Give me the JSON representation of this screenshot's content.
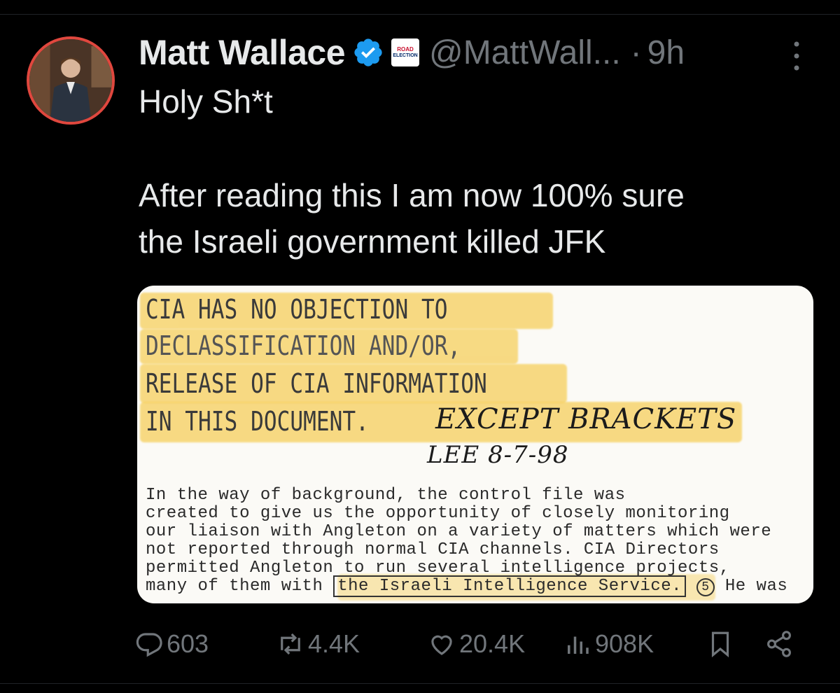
{
  "tweet": {
    "author_name": "Matt Wallace",
    "handle": "@MattWall...",
    "separator": "·",
    "time": "9h",
    "affiliation_badge": {
      "line1": "ROAD",
      "line2": "ELECTION"
    },
    "text_lines": [
      "Holy Sh*t",
      "After reading this I am now 100% sure",
      "the Israeli government killed JFK"
    ],
    "icons": {
      "verified": "verified-badge-icon",
      "more": "more-options-icon",
      "reply": "reply-icon",
      "retweet": "retweet-icon",
      "like": "like-icon",
      "views": "views-icon",
      "bookmark": "bookmark-icon",
      "share": "share-icon"
    },
    "colors": {
      "background": "#000000",
      "text": "#e7e9ea",
      "muted": "#71767b",
      "verified": "#1d9bf0",
      "avatar_ring": "#e0473e",
      "highlight": "#f6cf5c"
    }
  },
  "document": {
    "stamp_lines": [
      "CIA HAS NO OBJECTION TO",
      "DECLASSIFICATION AND/OR,",
      "RELEASE OF CIA INFORMATION",
      "IN THIS DOCUMENT."
    ],
    "handwriting_line1": "EXCEPT BRACKETS",
    "handwriting_line2": "LEE   8-7-98",
    "memo_lines": [
      "    In the way of background, the control file was",
      "created to give us the opportunity of closely monitoring",
      "our liaison with Angleton on a variety of matters which were",
      "not reported through normal CIA channels.  CIA Directors",
      "permitted Angleton to run several intelligence projects,"
    ],
    "memo_last_prefix": "many of them with",
    "memo_bracketed": "the Israeli Intelligence Service.",
    "memo_circle": "5",
    "memo_last_suffix": "He was"
  },
  "actions": {
    "replies": "603",
    "retweets": "4.4K",
    "likes": "20.4K",
    "views": "908K"
  }
}
